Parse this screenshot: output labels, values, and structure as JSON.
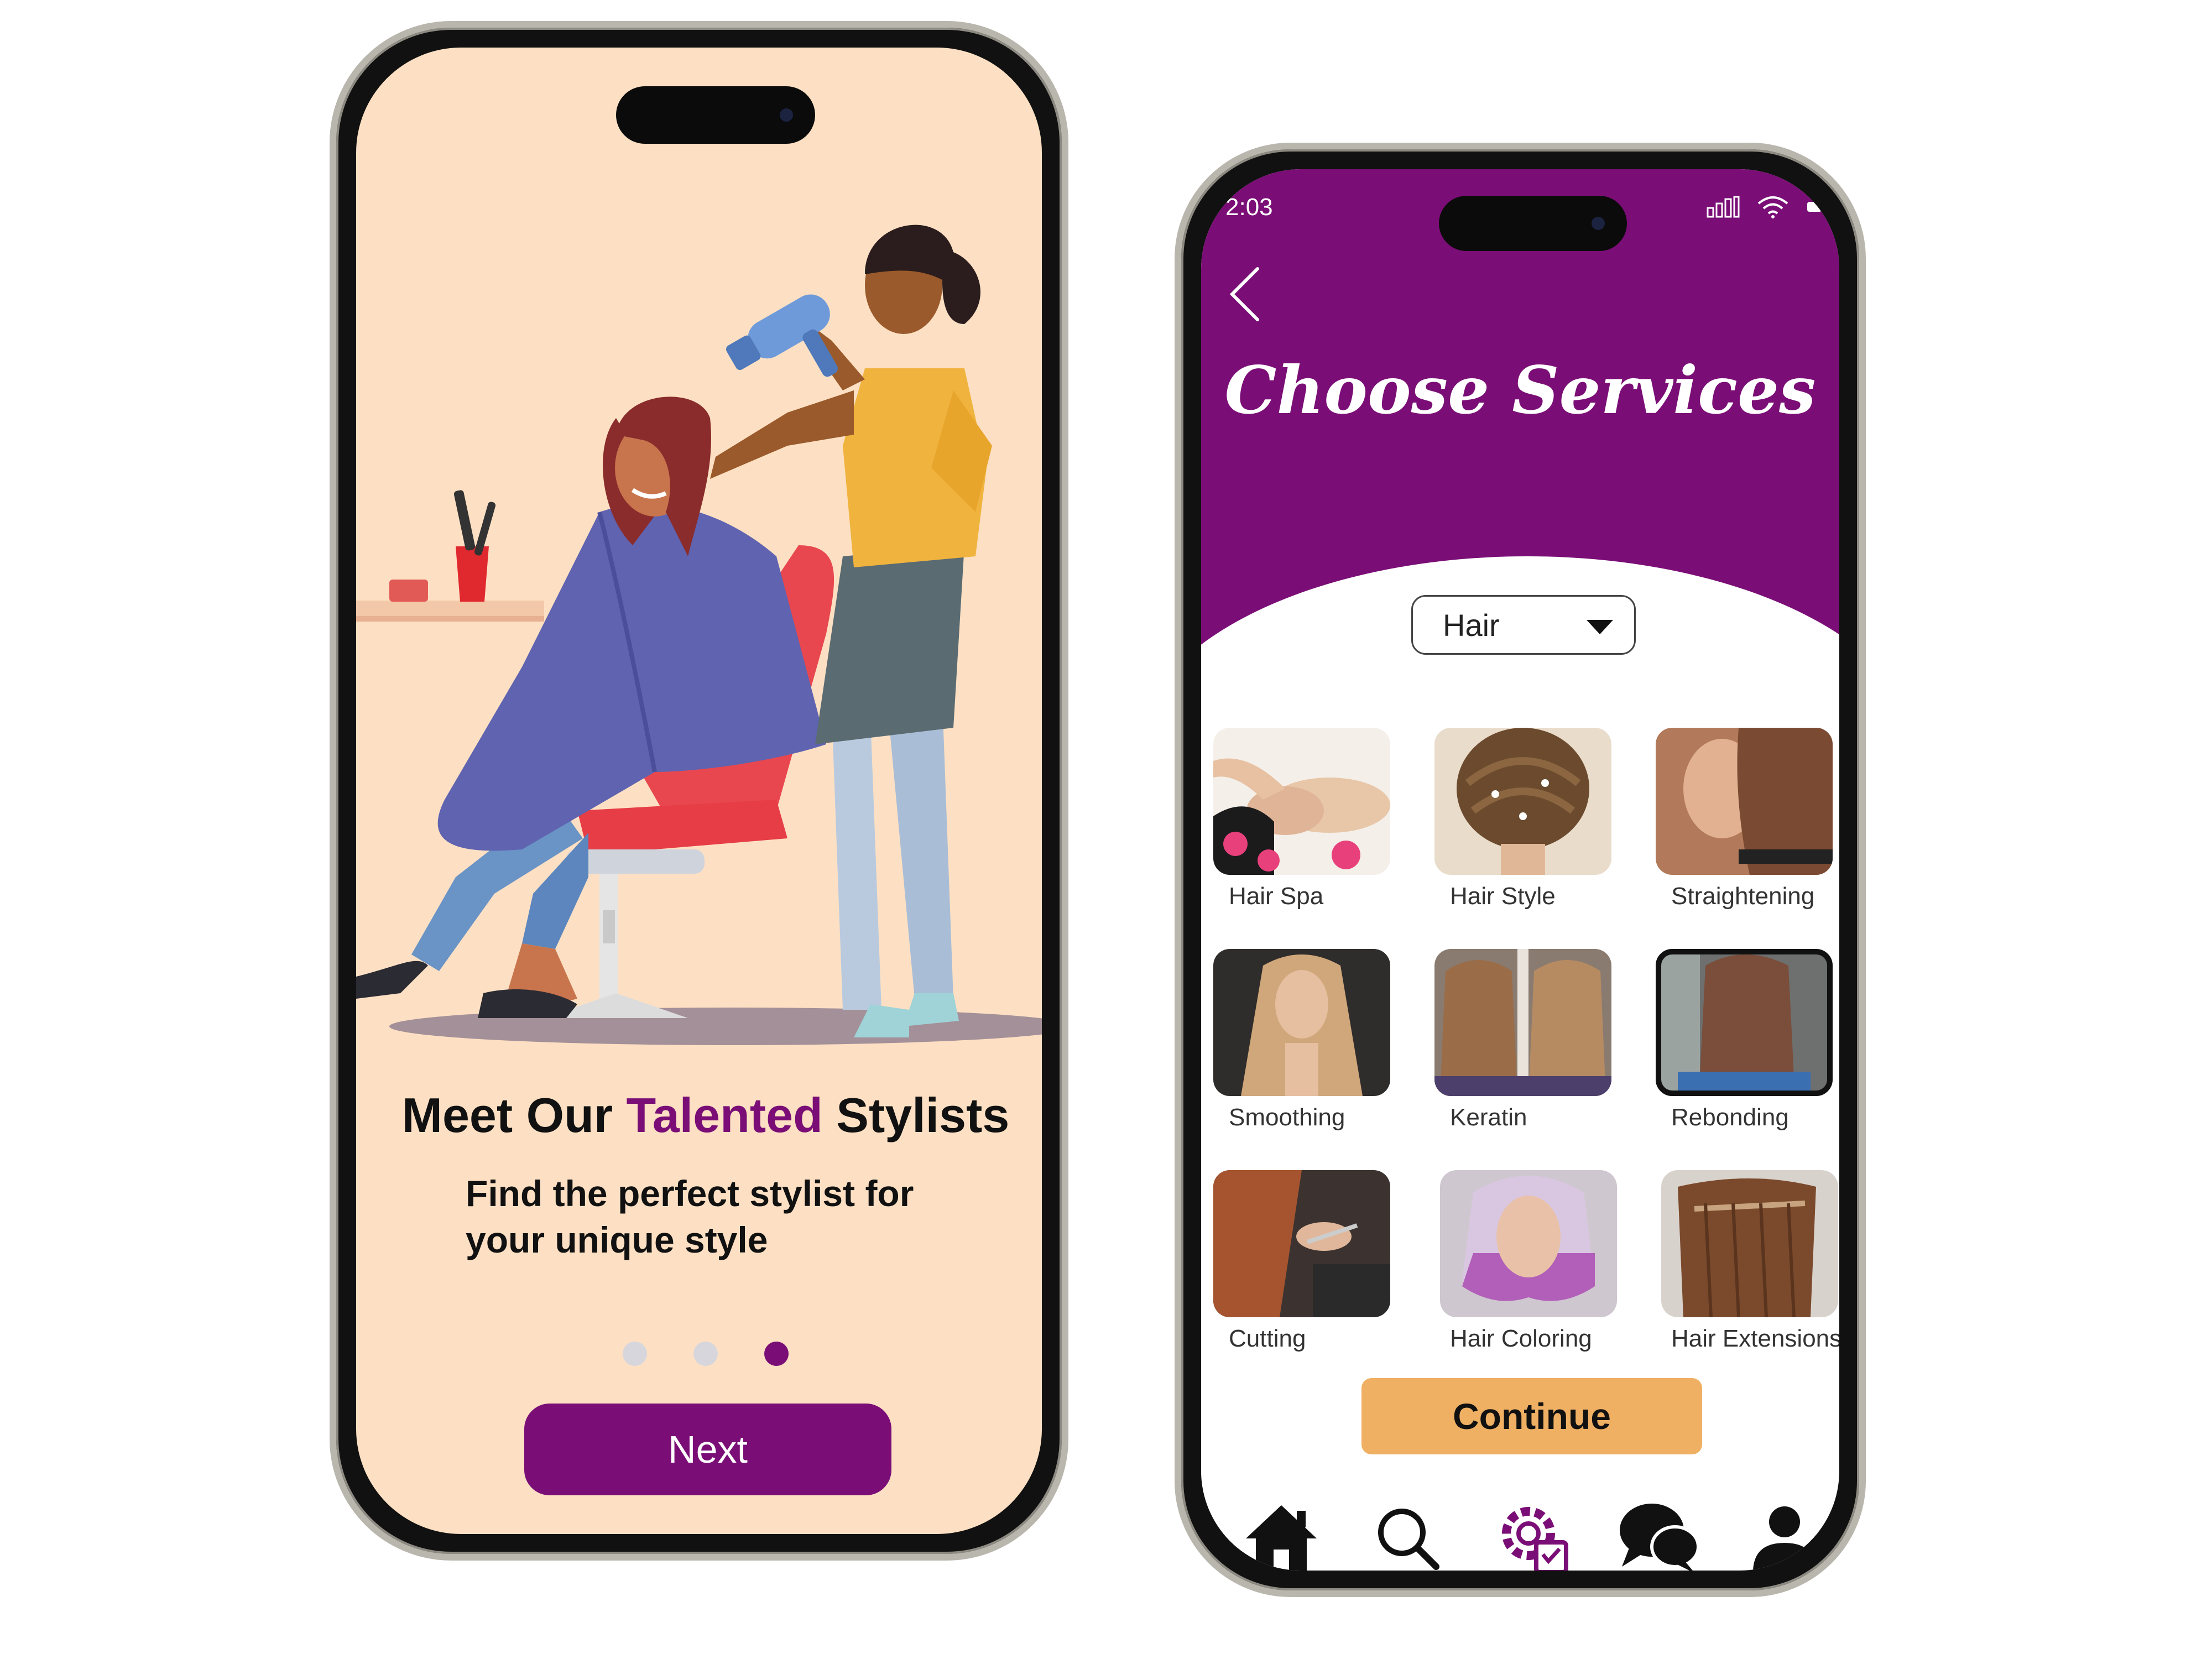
{
  "onboarding": {
    "headline_part1": "Meet Our",
    "headline_accent": "Talented",
    "headline_part2": "Stylists",
    "subtitle_line1": "Find the perfect stylist for",
    "subtitle_line2": "your unique style",
    "page_indicator": {
      "total": 3,
      "active": 3
    },
    "next_label": "Next"
  },
  "services": {
    "status": {
      "time": "2:03"
    },
    "title": "Choose Services",
    "category": {
      "selected": "Hair"
    },
    "items": [
      {
        "label": "Hair Spa"
      },
      {
        "label": "Hair Style"
      },
      {
        "label": "Straightening"
      },
      {
        "label": "Smoothing"
      },
      {
        "label": "Keratin"
      },
      {
        "label": "Rebonding",
        "selected": true
      },
      {
        "label": "Cutting"
      },
      {
        "label": "Hair  Coloring"
      },
      {
        "label": "Hair Extensions"
      }
    ],
    "continue_label": "Continue",
    "nav": [
      "home-icon",
      "search-icon",
      "services-gear-icon",
      "chat-icon",
      "profile-icon"
    ]
  },
  "colors": {
    "brand_purple": "#7a0e76",
    "peach_background": "#fde0c3",
    "continue_orange": "#efb063"
  }
}
